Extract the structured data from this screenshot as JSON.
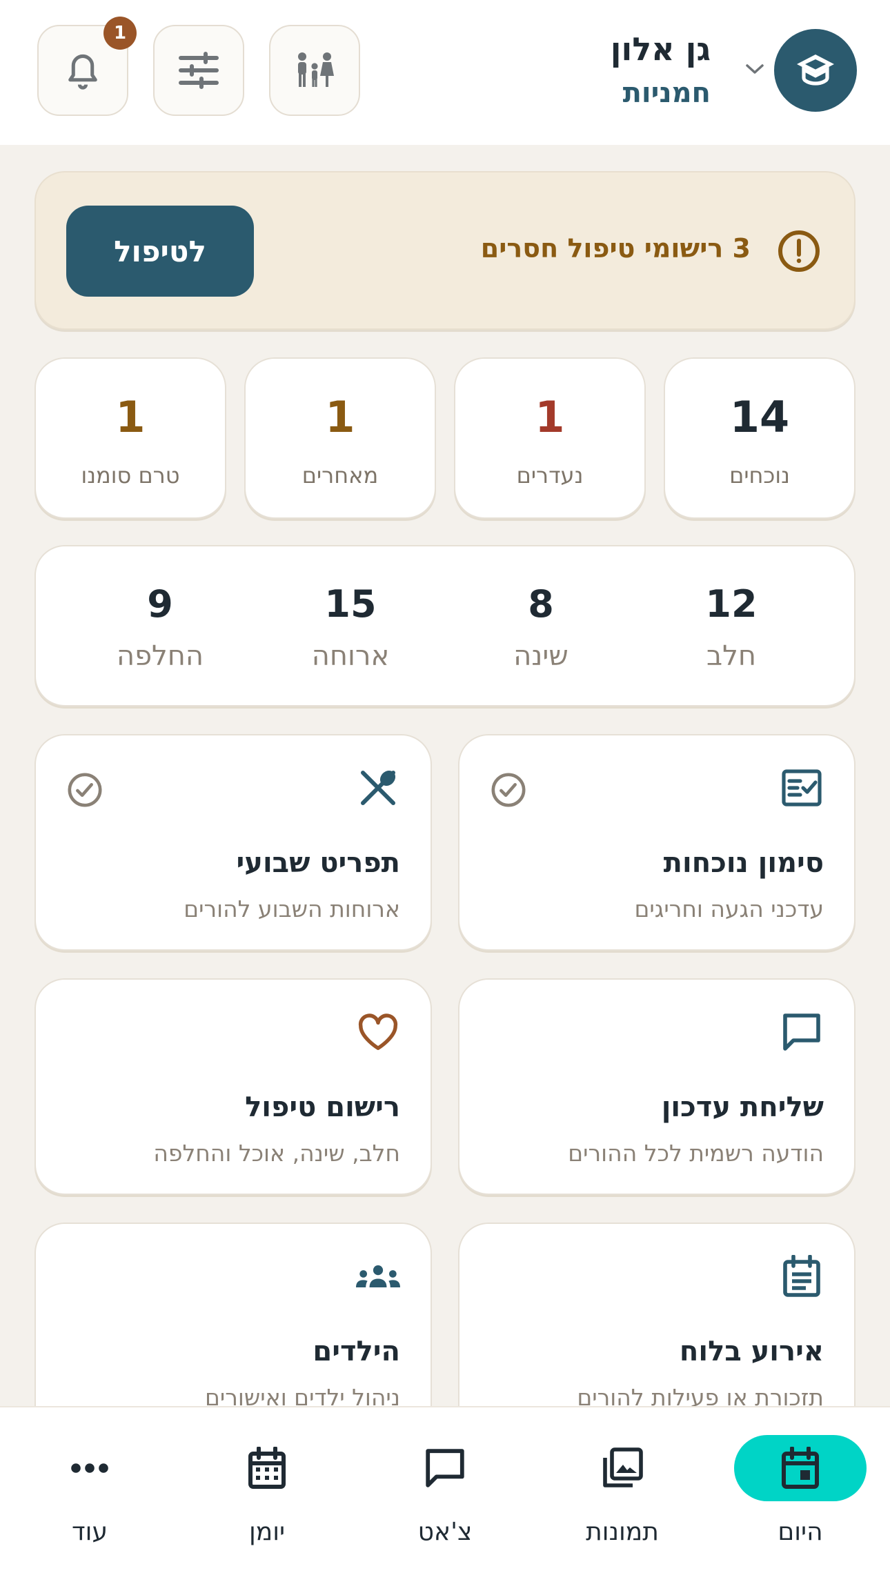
{
  "header": {
    "group_name": "גן אלון",
    "group_subtitle": "חמניות",
    "notifications_count": "1"
  },
  "alert": {
    "text": "3 רישומי טיפול חסרים",
    "button_label": "לטיפול"
  },
  "stats": [
    {
      "value": "14",
      "label": "נוכחים",
      "color": "#1f2a33"
    },
    {
      "value": "1",
      "label": "נעדרים",
      "color": "#a33a2a"
    },
    {
      "value": "1",
      "label": "מאחרים",
      "color": "#8a5a12"
    },
    {
      "value": "1",
      "label": "טרם סומנו",
      "color": "#8a5a12"
    }
  ],
  "care_summary": [
    {
      "value": "12",
      "label": "חלב"
    },
    {
      "value": "8",
      "label": "שינה"
    },
    {
      "value": "15",
      "label": "ארוחה"
    },
    {
      "value": "9",
      "label": "החלפה"
    }
  ],
  "actions": [
    {
      "title": "סימון נוכחות",
      "desc": "עדכני הגעה וחריגים",
      "icon": "checklist-icon",
      "done": true
    },
    {
      "title": "תפריט שבועי",
      "desc": "ארוחות השבוע להורים",
      "icon": "utensils-icon",
      "done": true
    },
    {
      "title": "שליחת עדכון",
      "desc": "הודעה רשמית לכל ההורים",
      "icon": "chat-icon",
      "done": false
    },
    {
      "title": "רישום טיפול",
      "desc": "חלב, שינה, אוכל והחלפה",
      "icon": "heart-icon",
      "done": false
    },
    {
      "title": "אירוע בלוח",
      "desc": "תזכורת או פעילות להורים",
      "icon": "calendar-event-icon",
      "done": false
    },
    {
      "title": "הילדים",
      "desc": "ניהול ילדים ואישורים",
      "icon": "group-icon",
      "done": false
    }
  ],
  "nav": [
    {
      "label": "היום",
      "icon": "today-icon",
      "active": true
    },
    {
      "label": "תמונות",
      "icon": "photos-icon",
      "active": false
    },
    {
      "label": "צ'אט",
      "icon": "chat-icon",
      "active": false
    },
    {
      "label": "יומן",
      "icon": "calendar-icon",
      "active": false
    },
    {
      "label": "עוד",
      "icon": "more-icon",
      "active": false
    }
  ],
  "colors": {
    "primary": "#2b5a6e",
    "accent": "#00d4c6",
    "warning": "#8a5a12",
    "danger": "#a33a2a",
    "badge": "#9a5528"
  }
}
